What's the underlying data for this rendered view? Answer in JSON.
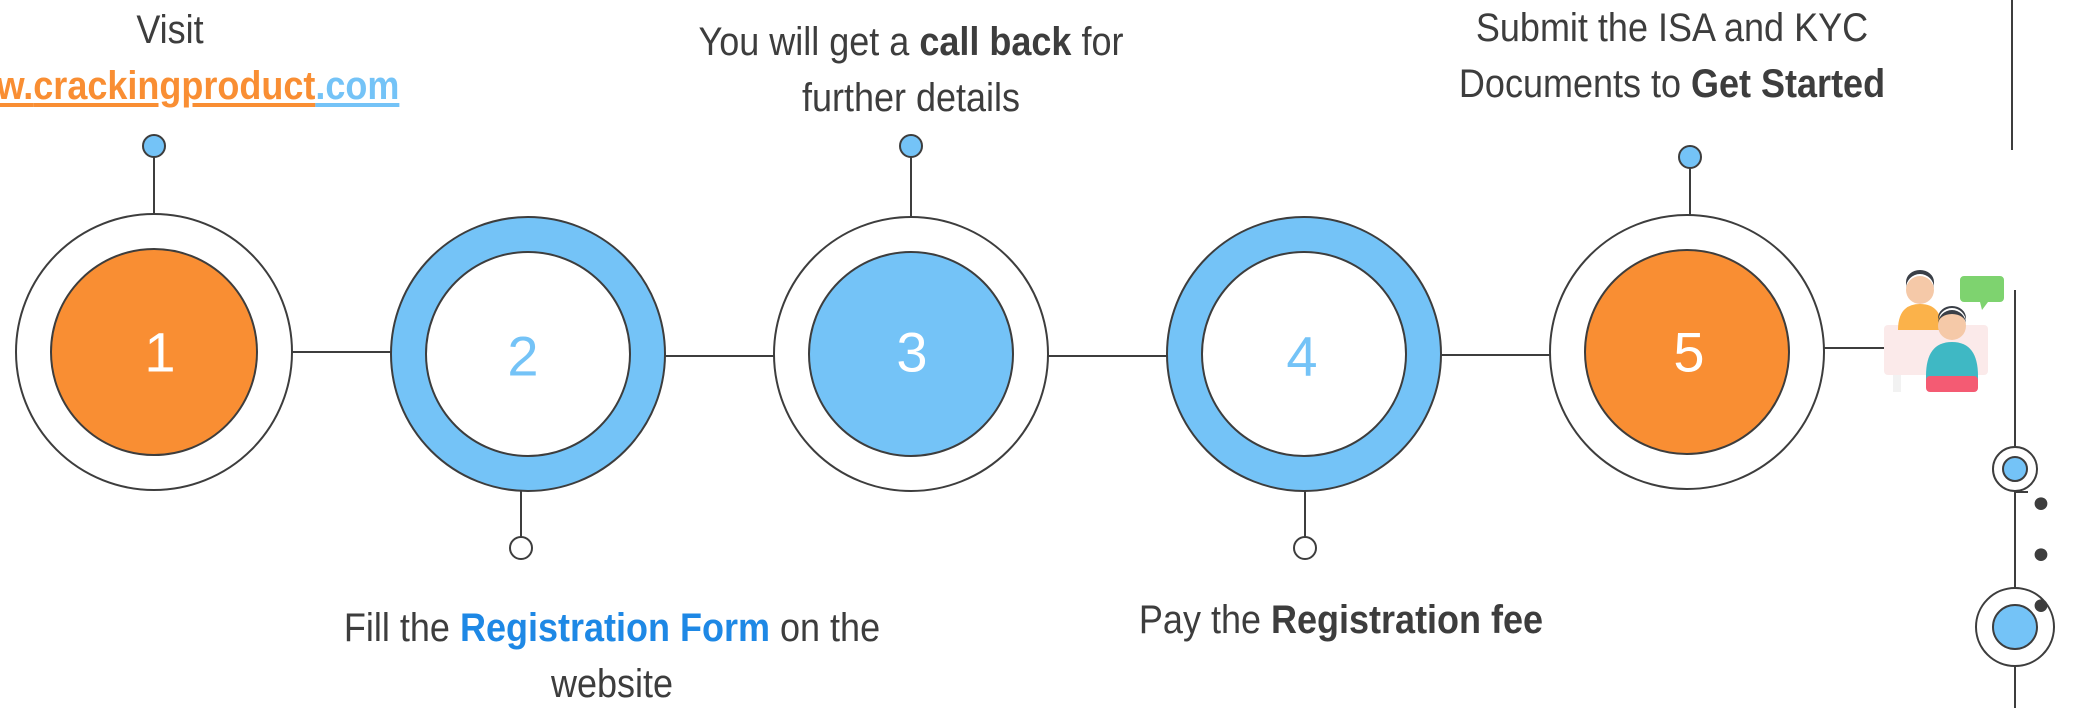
{
  "steps": [
    {
      "number": "1",
      "style": "orange-fill",
      "caption": {
        "line1": "Visit",
        "link_prefix": "www.",
        "link_main": "crackingproduct",
        "link_suffix": ".com"
      }
    },
    {
      "number": "2",
      "style": "blue-ring",
      "caption": {
        "pre": "Fill the ",
        "strong": "Registration Form",
        "post": " on the",
        "line2": "website"
      }
    },
    {
      "number": "3",
      "style": "blue-fill",
      "caption": {
        "pre": "You will get a ",
        "strong": "call back",
        "post": " for",
        "line2": "further details"
      }
    },
    {
      "number": "4",
      "style": "blue-ring",
      "caption": {
        "pre": "Pay the ",
        "strong": "Registration fee"
      }
    },
    {
      "number": "5",
      "style": "orange-fill",
      "caption": {
        "line1": "Submit the ISA and KYC",
        "pre2": "Documents to ",
        "strong2": "Get Started"
      }
    }
  ],
  "more_indicator": "• • •",
  "colors": {
    "orange": "#f98e33",
    "light_blue": "#74c3f7",
    "strong_blue": "#1e88e5",
    "text": "#3d3d3d",
    "line": "#3d3d3d"
  }
}
